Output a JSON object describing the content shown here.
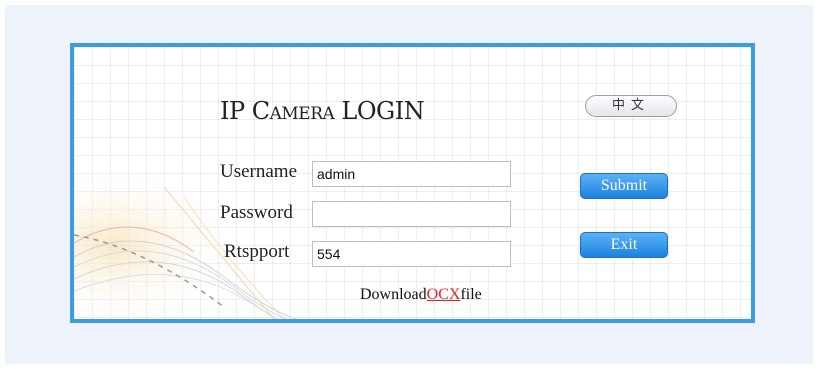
{
  "login": {
    "title": "IP Camera LOGIN",
    "language_button": "中文",
    "fields": {
      "username": {
        "label": "Username",
        "value": "admin"
      },
      "password": {
        "label": "Password",
        "value": ""
      },
      "rtspport": {
        "label": "Rtspport",
        "value": "554"
      }
    },
    "submit_label": "Submit",
    "exit_label": "Exit",
    "download": {
      "prefix": "Download",
      "link_text": "OCX",
      "suffix": "file"
    }
  },
  "colors": {
    "frame_border": "#3d9be0",
    "button_blue": "#1c82df",
    "link_red": "#e0241f",
    "outer_background": "#eef3fb"
  }
}
